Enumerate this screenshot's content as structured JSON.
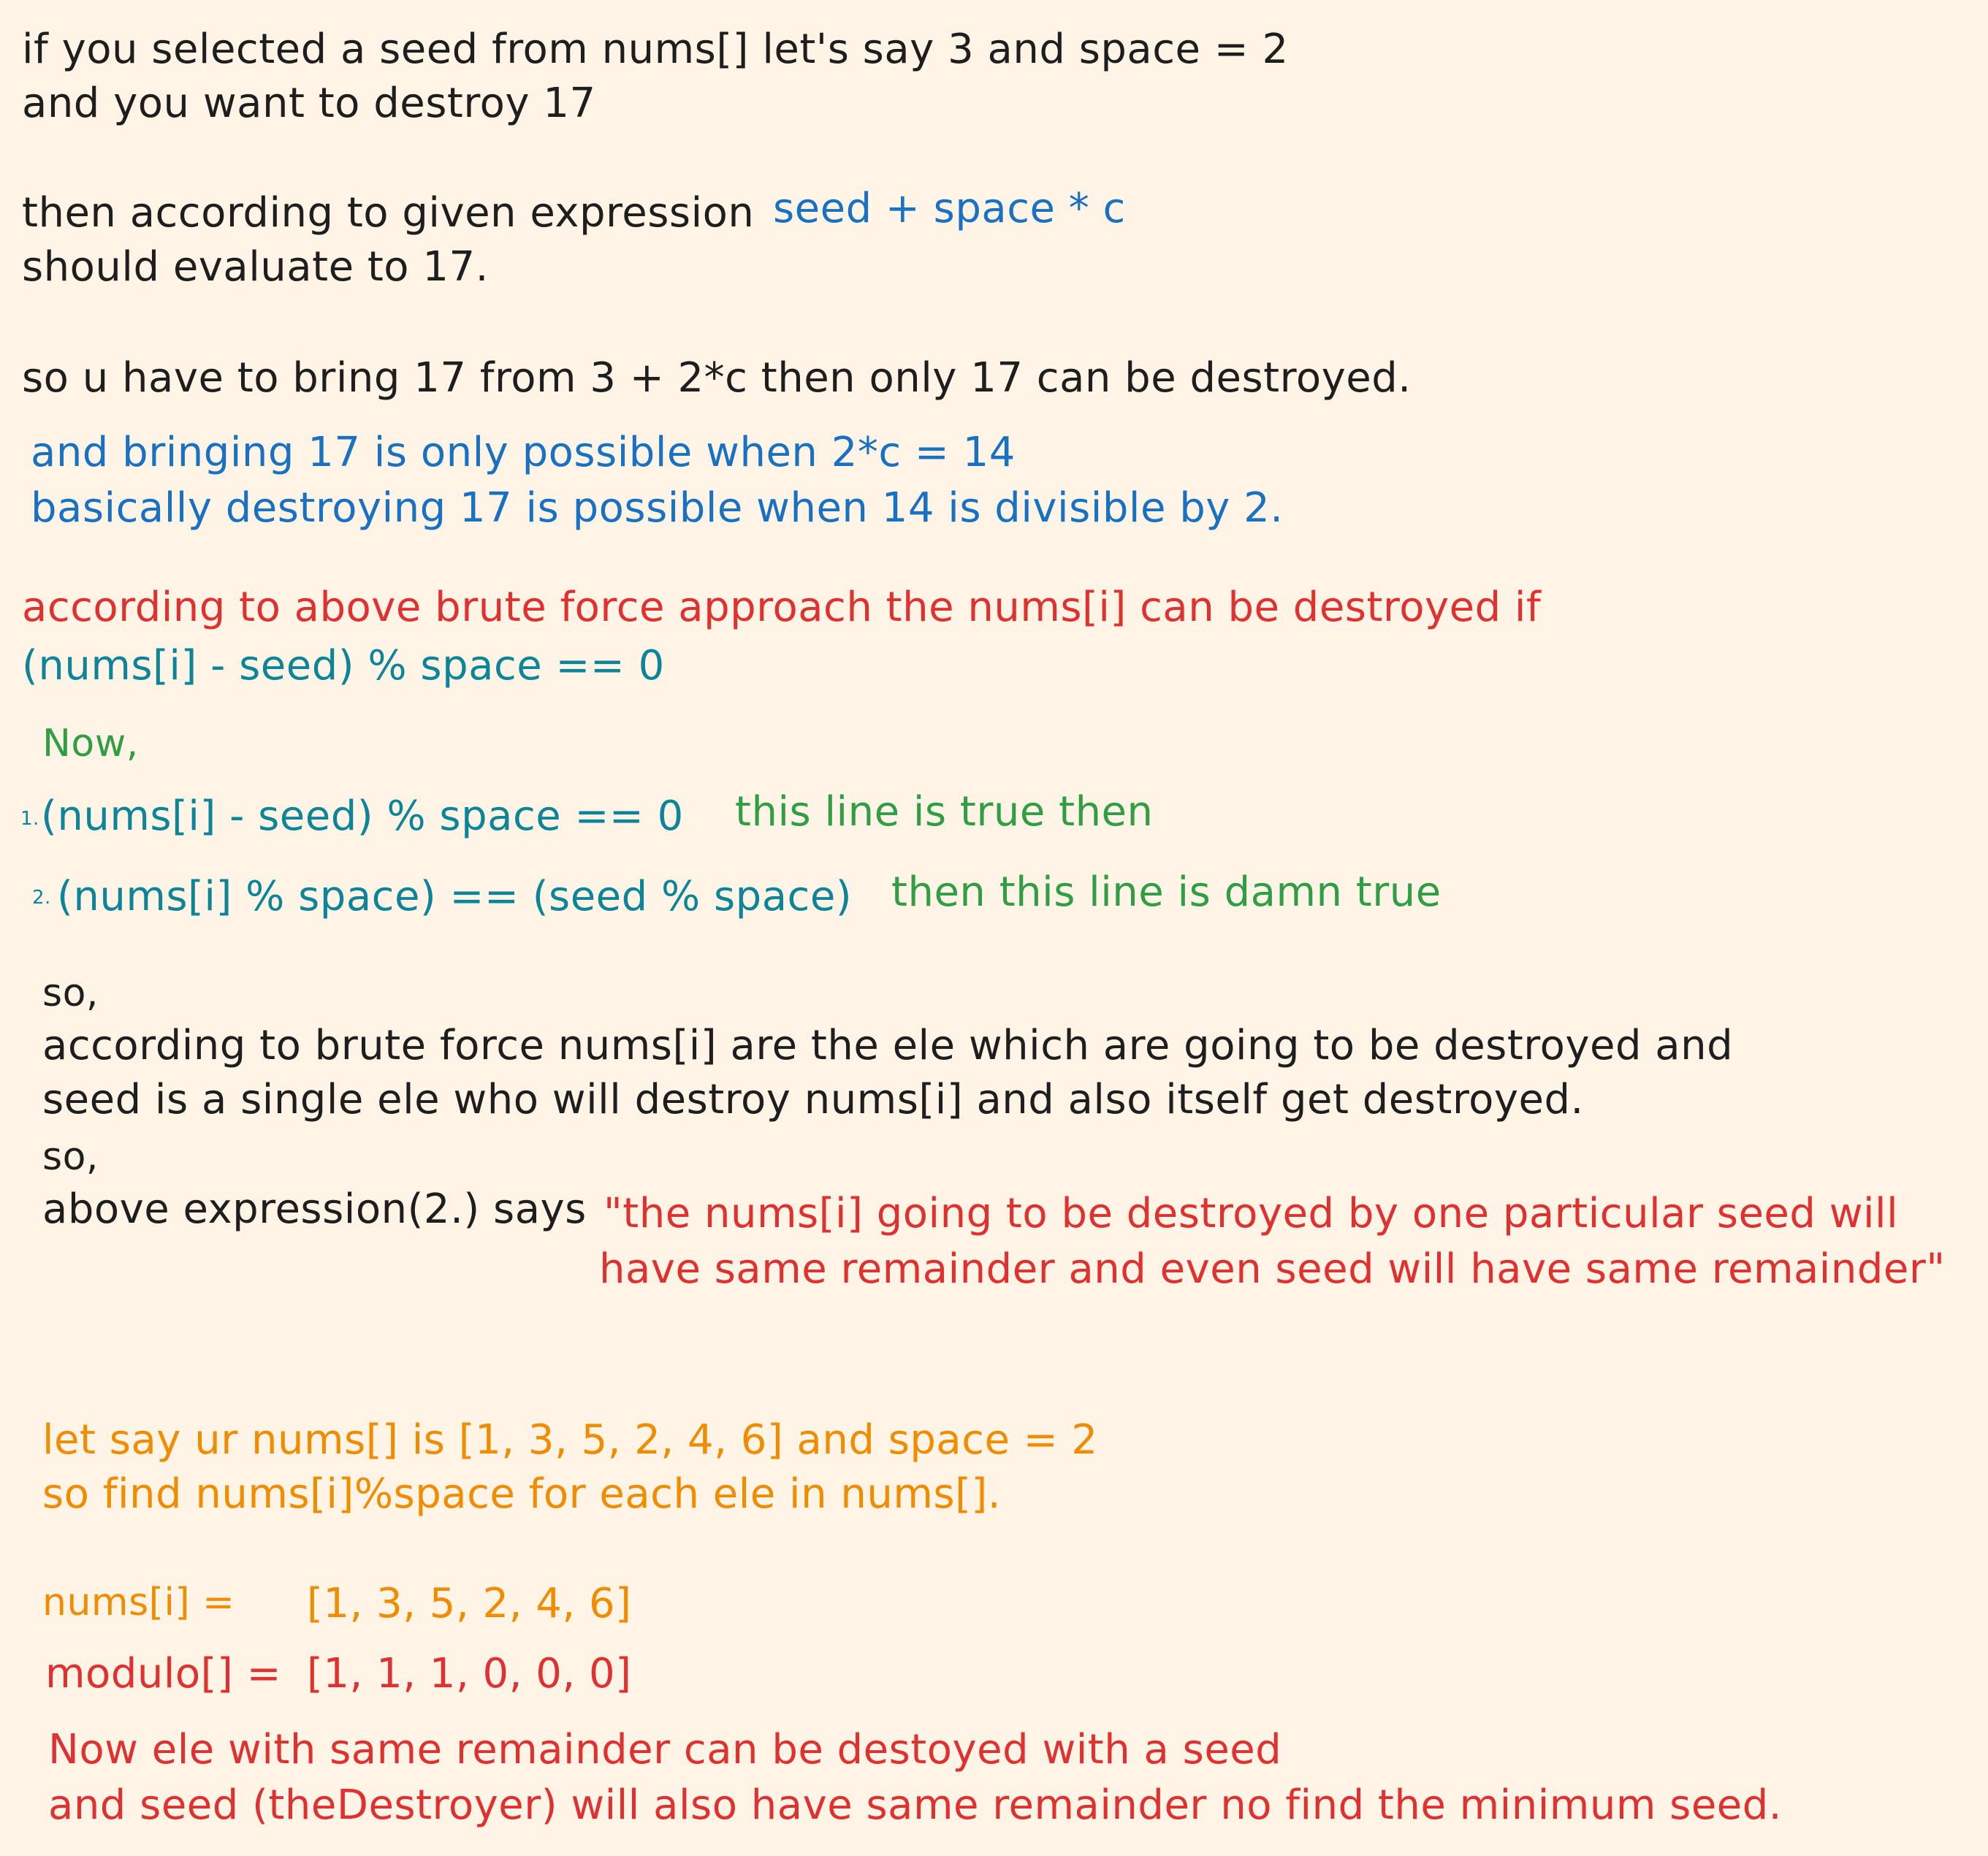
{
  "colors": {
    "background": "#fff4e6",
    "black": "#1e1e1e",
    "blue": "#1971c2",
    "red": "#e03131",
    "teal": "#0c8599",
    "green": "#2f9e44",
    "orange": "#f08c00"
  },
  "intro": {
    "line1": "if you selected a seed from nums[] let's say 3 and space = 2",
    "line2": "and you want to destroy 17",
    "line3_prefix": "then according to given expression",
    "line3_expr": "seed + space * c",
    "line4": "should evaluate to 17.",
    "line5": "so u have to bring 17 from 3 + 2*c then only 17 can be destroyed."
  },
  "blue_note": {
    "line1": "and bringing 17 is only possible when 2*c = 14",
    "line2": "basically destroying 17 is possible when 14 is divisible by 2."
  },
  "brute_force": {
    "line1": "according to above brute force approach the nums[i] can be destroyed if",
    "line2": "(nums[i] - seed) % space == 0"
  },
  "now": {
    "heading": "Now,",
    "item1_num": "1.",
    "item1_expr": "(nums[i] - seed) % space == 0",
    "item1_note": "this line is true then",
    "item2_num": "2.",
    "item2_expr": "(nums[i] % space) == (seed % space)",
    "item2_note": "then this line is damn true"
  },
  "so_section": {
    "so1": "so,",
    "line1": "according to brute force nums[i] are the ele which are going to be destroyed and",
    "line2": "seed is a single ele who will destroy nums[i] and also itself get destroyed.",
    "so2": "so,",
    "line3_prefix": "above expression(2.) says",
    "quote_line1": "\"the nums[i] going to be destroyed by one particular seed will",
    "quote_line2": "have same remainder and even seed will have same remainder\""
  },
  "example": {
    "line1": "let say ur nums[] is [1, 3, 5, 2, 4, 6] and space = 2",
    "line2": "so find nums[i]%space for each ele in nums[].",
    "nums_label": "nums[i] =",
    "nums_values": "[1, 3, 5, 2, 4, 6]",
    "modulo_label": "modulo[] =",
    "modulo_values": "[1, 1, 1, 0, 0, 0]",
    "conclusion1": "Now ele with same remainder can be destoyed with a seed",
    "conclusion2": "and seed (theDestroyer) will also have same remainder no find the minimum seed."
  }
}
